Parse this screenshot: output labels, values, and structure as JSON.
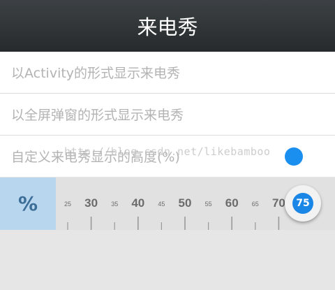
{
  "titlebar": {
    "title": "来电秀"
  },
  "settings": {
    "items": [
      {
        "label": "以Activity的形式显示来电秀"
      },
      {
        "label": "以全屏弹窗的形式显示来电秀"
      },
      {
        "label": "自定义来电秀显示的高度(%)"
      }
    ]
  },
  "watermark": {
    "text": "http://blog.csdn.net/likebamboo"
  },
  "ruler": {
    "unit_label": "%",
    "ticks": [
      "25",
      "30",
      "35",
      "40",
      "45",
      "50",
      "55",
      "60",
      "65",
      "70"
    ],
    "min": 25,
    "max": 75,
    "selected_value": 75,
    "selected_label": "75"
  },
  "colors": {
    "accent": "#1a86e6",
    "unit_box": "#b8d6ee",
    "titlebar": "#2d3133"
  }
}
